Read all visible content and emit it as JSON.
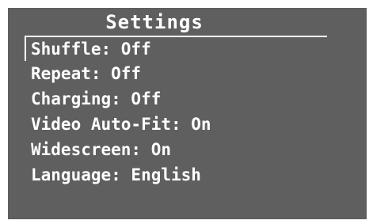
{
  "screen": {
    "title": "Settings"
  },
  "menu": {
    "items": [
      {
        "label": "Shuffle: Off"
      },
      {
        "label": "Repeat: Off"
      },
      {
        "label": "Charging: Off"
      },
      {
        "label": "Video Auto-Fit: On"
      },
      {
        "label": "Widescreen: On"
      },
      {
        "label": "Language: English"
      }
    ],
    "selected_index": 0
  },
  "colors": {
    "background": "#5f5f5f",
    "text": "#ffffff",
    "page": "#ffffff"
  }
}
